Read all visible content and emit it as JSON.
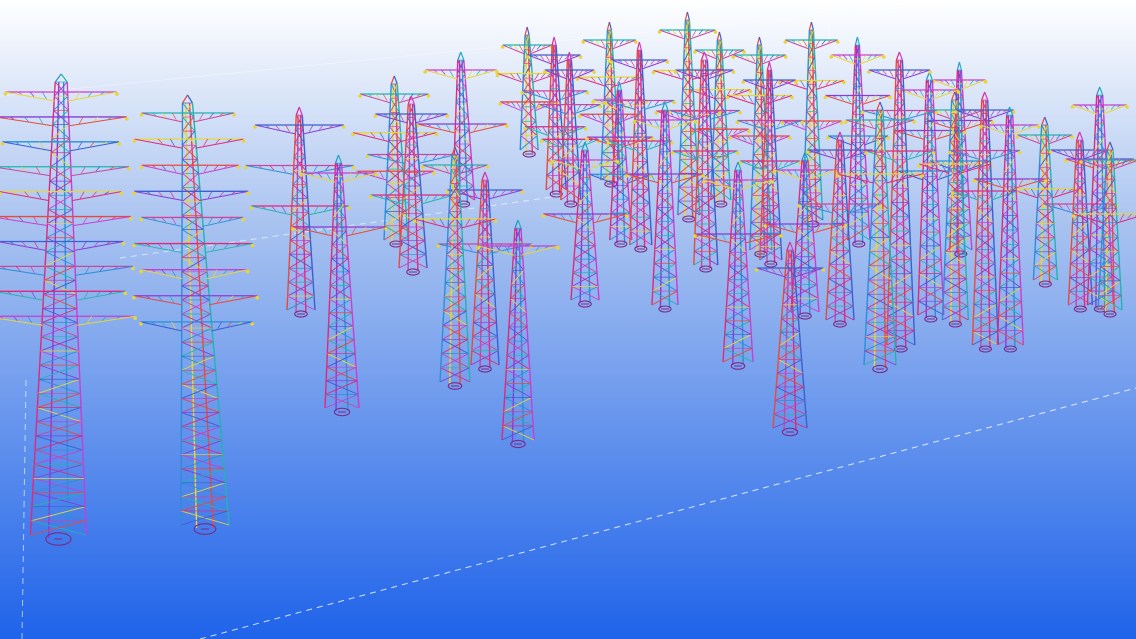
{
  "viewport": {
    "background": {
      "top_color": "#ffffff",
      "mid_color": "#a9c3f0",
      "bottom_color": "#1f63ea"
    },
    "member_colors": [
      "#e0297b",
      "#c93dd3",
      "#8a3bd6",
      "#2a8fd8",
      "#1fb5b0",
      "#e7d53a",
      "#e84a3c",
      "#3a5fd0",
      "#c9489b"
    ],
    "grid_line_color": "#ffffff",
    "towers": [
      {
        "id": "t01",
        "kind": "multi-circuit"
      },
      {
        "id": "t02",
        "kind": "multi-circuit"
      },
      {
        "id": "t03",
        "kind": "double-circuit"
      },
      {
        "id": "t04",
        "kind": "double-circuit"
      },
      {
        "id": "t05",
        "kind": "double-circuit"
      },
      {
        "id": "t06",
        "kind": "double-circuit"
      },
      {
        "id": "t07",
        "kind": "single-circuit"
      },
      {
        "id": "t08",
        "kind": "single-circuit"
      },
      {
        "id": "t09",
        "kind": "single-circuit"
      },
      {
        "id": "t10",
        "kind": "single-circuit"
      },
      {
        "id": "t11",
        "kind": "double-circuit"
      },
      {
        "id": "t12",
        "kind": "double-circuit"
      },
      {
        "id": "t13",
        "kind": "double-circuit"
      },
      {
        "id": "t14",
        "kind": "double-circuit"
      },
      {
        "id": "t15",
        "kind": "double-circuit"
      },
      {
        "id": "t16",
        "kind": "double-circuit"
      },
      {
        "id": "t17",
        "kind": "double-circuit"
      },
      {
        "id": "t18",
        "kind": "double-circuit"
      },
      {
        "id": "t19",
        "kind": "double-circuit"
      },
      {
        "id": "t20",
        "kind": "double-circuit"
      },
      {
        "id": "t21",
        "kind": "double-circuit"
      },
      {
        "id": "t22",
        "kind": "double-circuit"
      },
      {
        "id": "t23",
        "kind": "double-circuit"
      },
      {
        "id": "t24",
        "kind": "double-circuit"
      },
      {
        "id": "t25",
        "kind": "double-circuit"
      },
      {
        "id": "t26",
        "kind": "double-circuit"
      },
      {
        "id": "t27",
        "kind": "double-circuit"
      },
      {
        "id": "t28",
        "kind": "double-circuit"
      },
      {
        "id": "t29",
        "kind": "double-circuit"
      },
      {
        "id": "t30",
        "kind": "double-circuit"
      },
      {
        "id": "t31",
        "kind": "double-circuit"
      },
      {
        "id": "t32",
        "kind": "double-circuit"
      },
      {
        "id": "t33",
        "kind": "double-circuit"
      },
      {
        "id": "t34",
        "kind": "double-circuit"
      },
      {
        "id": "t35",
        "kind": "double-circuit"
      },
      {
        "id": "t36",
        "kind": "double-circuit"
      },
      {
        "id": "t37",
        "kind": "double-circuit"
      },
      {
        "id": "t38",
        "kind": "double-circuit"
      },
      {
        "id": "t39",
        "kind": "double-circuit"
      },
      {
        "id": "t40",
        "kind": "double-circuit"
      }
    ]
  }
}
